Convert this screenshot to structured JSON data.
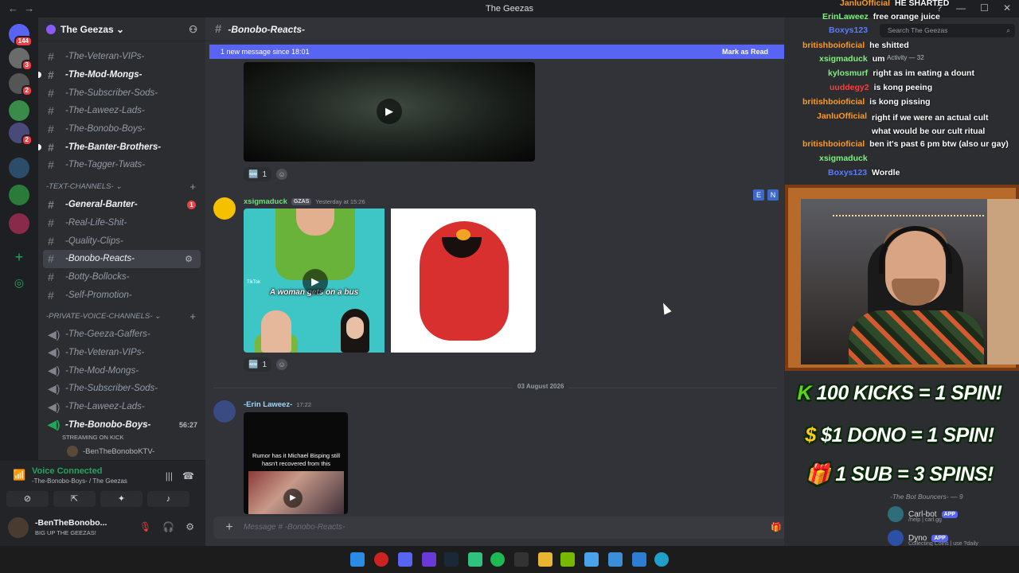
{
  "window": {
    "title": "The Geezas"
  },
  "server_rail": {
    "mention_badge": "144",
    "badge_2": "3",
    "badge_3": "2",
    "badge_4": "2"
  },
  "sidebar": {
    "guild_name": "The Geezas",
    "top_channels": [
      {
        "label": "-The-Veteran-VIPs-"
      },
      {
        "label": "-The-Mod-Mongs-"
      },
      {
        "label": "-The-Subscriber-Sods-"
      },
      {
        "label": "-The-Laweez-Lads-"
      },
      {
        "label": "-The-Bonobo-Boys-"
      },
      {
        "label": "-The-Banter-Brothers-"
      },
      {
        "label": "-The-Tagger-Twats-"
      }
    ],
    "text_category": "-TEXT-CHANNELS-",
    "text_channels": [
      {
        "label": "-General-Banter-",
        "unread": "1"
      },
      {
        "label": "-Real-Life-Shit-"
      },
      {
        "label": "-Quality-Clips-"
      },
      {
        "label": "-Bonobo-Reacts-"
      },
      {
        "label": "-Botty-Bollocks-"
      },
      {
        "label": "-Self-Promotion-"
      }
    ],
    "voice_category": "-PRIVATE-VOICE-CHANNELS-",
    "voice_channels": [
      {
        "label": "-The-Geeza-Gaffers-"
      },
      {
        "label": "-The-Veteran-VIPs-"
      },
      {
        "label": "-The-Mod-Mongs-"
      },
      {
        "label": "-The-Subscriber-Sods-"
      },
      {
        "label": "-The-Laweez-Lads-"
      },
      {
        "label": "-The-Bonobo-Boys-",
        "timer": "56:27"
      }
    ],
    "streaming_label": "STREAMING ON KICK",
    "voice_user": "-BenTheBonoboKTV-"
  },
  "voice_panel": {
    "title": "Voice Connected",
    "subtitle": "-The-Bonobo-Boys- / The Geezas"
  },
  "user_panel": {
    "name": "-BenTheBonobo...",
    "status": "BIG UP THE GEEZAS!"
  },
  "chat": {
    "channel_name": "-Bonobo-Reacts-",
    "new_messages_bar": "1 new message since 18:01",
    "mark_as_read": "Mark as Read",
    "reaction_count_1": "1",
    "message_2": {
      "author": "xsigmaduck",
      "tag": "GZAS",
      "time": "Yesterday at 15:26",
      "tiktok_caption": "A woman gets on a bus",
      "tiktok_label": "TikTok"
    },
    "reaction_count_2": "1",
    "date_separator": "03 August 2026",
    "message_3": {
      "author": "-Erin Laweez-",
      "time": "17:22",
      "video_text": "Rumor has it Michael Bisping still hasn't recovered from this"
    },
    "composer_placeholder": "Message # -Bonobo-Reacts-"
  },
  "search": {
    "placeholder": "Search The Geezas"
  },
  "stream_chat": [
    {
      "user": "JanluOfficial",
      "text": "HE SHARTED",
      "color": "#ff9a1f"
    },
    {
      "user": "ErinLaweez",
      "text": "free orange juice",
      "color": "#7ef07e"
    },
    {
      "user": "Boxys123",
      "text": "",
      "color": "#5b7bff"
    },
    {
      "user": "britishboioficial",
      "text": "he shitted",
      "color": "#ff9a1f"
    },
    {
      "user": "xsigmaduck",
      "text": "um",
      "color": "#7ef07e"
    },
    {
      "user": "kylosmurf",
      "text": "right as im eating a dount",
      "color": "#7ef07e"
    },
    {
      "user": "uuddegy2",
      "text": "is kong peeing",
      "color": "#ff3b3b"
    },
    {
      "user": "britishboioficial",
      "text": "is kong pissing",
      "color": "#ff9a1f"
    },
    {
      "user": "JanluOfficial",
      "text": "right if we were an actual cult what would be our cult ritual",
      "color": "#ff9a1f"
    },
    {
      "user": "britishboioficial",
      "text": "ben it's past 6 pm btw (also ur gay)",
      "color": "#ff9a1f"
    },
    {
      "user": "xsigmaduck",
      "text": "",
      "color": "#7ef07e"
    },
    {
      "user": "Boxys123",
      "text": "Wordle",
      "color": "#5b7bff"
    }
  ],
  "activity_label": "Activity — 32",
  "promo": {
    "line1": "100 KICKS = 1 SPIN!",
    "line1_prefix": "K",
    "line2": "$1 DONO = 1 SPIN!",
    "line2_prefix": "$",
    "line3": "1 SUB = 3 SPINS!"
  },
  "members": {
    "category": "-The Bot Bouncers- — 9",
    "bots": [
      {
        "name": "Carl-bot",
        "badge": "APP",
        "sub": "/help | carl.gg"
      },
      {
        "name": "Dyno",
        "badge": "APP",
        "sub": "Collecting Coins | use ?daily"
      }
    ]
  },
  "colors": {
    "blurple": "#5865f2",
    "green": "#23a55a",
    "red": "#f23f43"
  }
}
